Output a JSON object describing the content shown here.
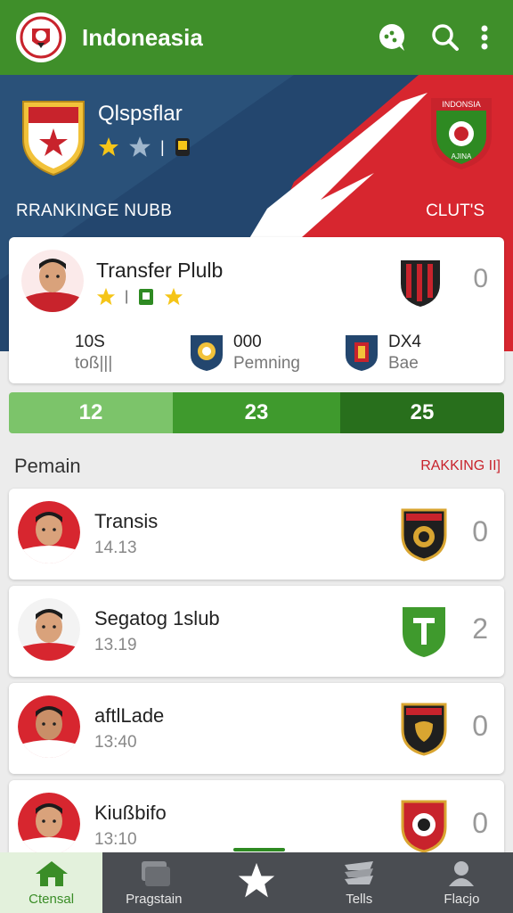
{
  "app": {
    "title": "Indoneasia"
  },
  "hero": {
    "team_name": "Qlspsflar",
    "left_label": "RRANKINGE NUBB",
    "right_label": "CLUT'S",
    "right_crest_text": "INDONSIA",
    "right_crest_sub": "AJINA"
  },
  "featured": {
    "name": "Transfer Plulb",
    "score": "0",
    "stats": [
      {
        "line1": "10S",
        "line2": "toß|||"
      },
      {
        "line1": "000",
        "line2": "Pemning"
      },
      {
        "line1": "DX4",
        "line2": "Bae"
      }
    ]
  },
  "scorebar": {
    "values": [
      "12",
      "23",
      "25"
    ]
  },
  "section": {
    "title": "Pemain",
    "link": "RAKKING II]"
  },
  "rows": [
    {
      "name": "Transis",
      "sub": "14.13",
      "score": "0"
    },
    {
      "name": "Segatog 1slub",
      "sub": "13.19",
      "score": "2"
    },
    {
      "name": "aftlLade",
      "sub": "13:40",
      "score": "0"
    },
    {
      "name": "Kiußbifo",
      "sub": "13:10",
      "score": "0"
    }
  ],
  "nav": [
    {
      "label": "Ctensal",
      "icon": "home-icon",
      "active": true
    },
    {
      "label": "Pragstain",
      "icon": "cards-icon",
      "active": false
    },
    {
      "label": "",
      "icon": "star-icon",
      "active": false
    },
    {
      "label": "Tells",
      "icon": "layers-icon",
      "active": false
    },
    {
      "label": "Flacjo",
      "icon": "profile-icon",
      "active": false
    }
  ],
  "colors": {
    "primary": "#3f8f2a",
    "accent_red": "#c8232c",
    "navy": "#23466e",
    "nav_bg": "#4a4d52"
  }
}
